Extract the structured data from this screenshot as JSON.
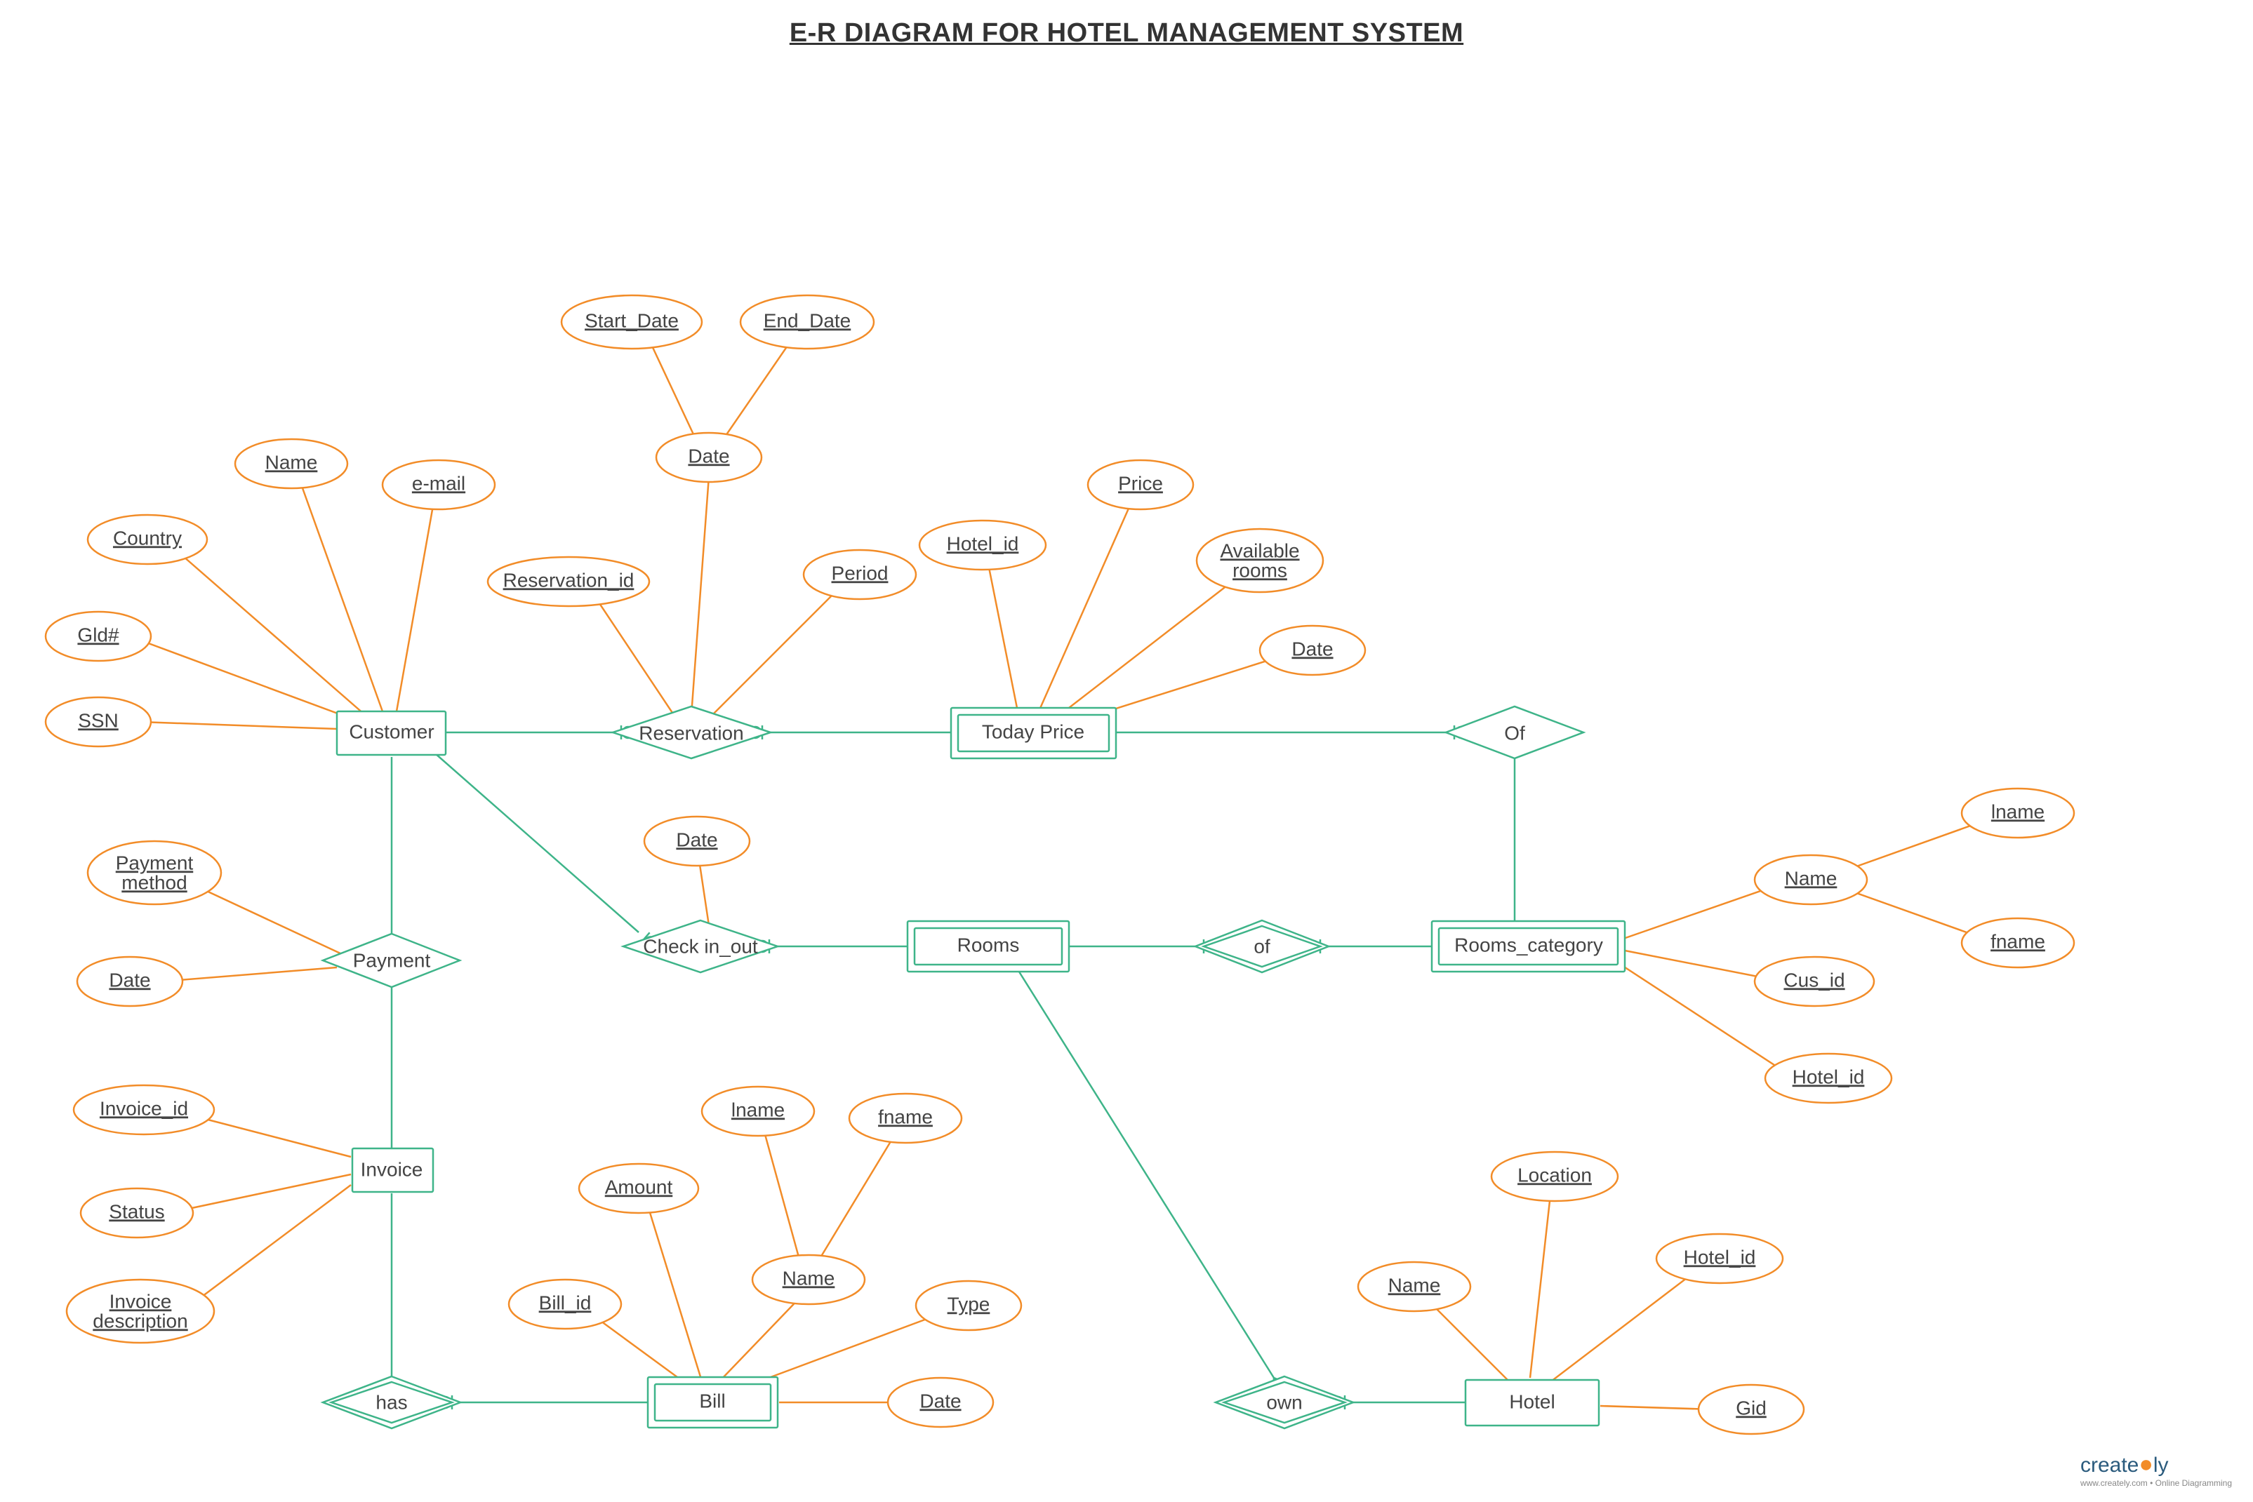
{
  "title": "E-R DIAGRAM FOR HOTEL MANAGEMENT SYSTEM",
  "footer": {
    "brand": "create",
    "suffix": "ly",
    "tagline": "www.creately.com • Online Diagramming"
  },
  "entities": {
    "customer": "Customer",
    "invoice": "Invoice",
    "today_price": "Today Price",
    "rooms": "Rooms",
    "rooms_category": "Rooms_category",
    "hotel": "Hotel",
    "bill": "Bill"
  },
  "relationships": {
    "reservation": "Reservation",
    "payment": "Payment",
    "check_in_out": "Check in_out",
    "of_top": "Of",
    "of_mid": "of",
    "has": "has",
    "own": "own"
  },
  "attributes": {
    "ssn": "SSN",
    "gld": "Gld#",
    "country": "Country",
    "name_cust": "Name",
    "email": "e-mail",
    "start_date": "Start_Date",
    "end_date": "End_Date",
    "date_res": "Date",
    "reservation_id": "Reservation_id",
    "period": "Period",
    "hotel_id_tp": "Hotel_id",
    "price": "Price",
    "available_rooms_l1": "Available",
    "available_rooms_l2": "rooms",
    "date_tp": "Date",
    "payment_method_l1": "Payment",
    "payment_method_l2": "method",
    "date_pay": "Date",
    "invoice_id": "Invoice_id",
    "status": "Status",
    "invoice_desc_l1": "Invoice",
    "invoice_desc_l2": "description",
    "date_check": "Date",
    "lname_rc": "lname",
    "fname_rc": "fname",
    "name_rc": "Name",
    "cus_id": "Cus_id",
    "hotel_id_rc": "Hotel_id",
    "bill_id": "Bill_id",
    "amount": "Amount",
    "lname_bill": "lname",
    "fname_bill": "fname",
    "name_bill": "Name",
    "type_bill": "Type",
    "date_bill": "Date",
    "name_hotel": "Name",
    "location": "Location",
    "hotel_id_h": "Hotel_id",
    "gid": "Gid"
  }
}
